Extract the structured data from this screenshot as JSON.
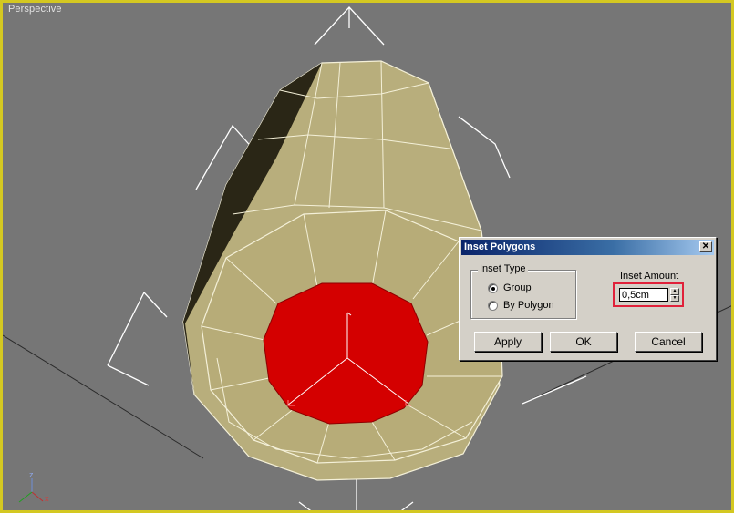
{
  "viewport": {
    "label": "Perspective",
    "border_color": "#d4c821",
    "selection_color": "#d40000",
    "axis": {
      "z": "z",
      "x": "x"
    }
  },
  "dialog": {
    "title": "Inset Polygons",
    "close_label": "✕",
    "inset_type": {
      "label": "Inset Type",
      "options": [
        {
          "label": "Group",
          "selected": true
        },
        {
          "label": "By Polygon",
          "selected": false
        }
      ]
    },
    "inset_amount": {
      "label": "Inset Amount",
      "value": "0,5cm"
    },
    "buttons": {
      "apply": "Apply",
      "ok": "OK",
      "cancel": "Cancel"
    }
  }
}
